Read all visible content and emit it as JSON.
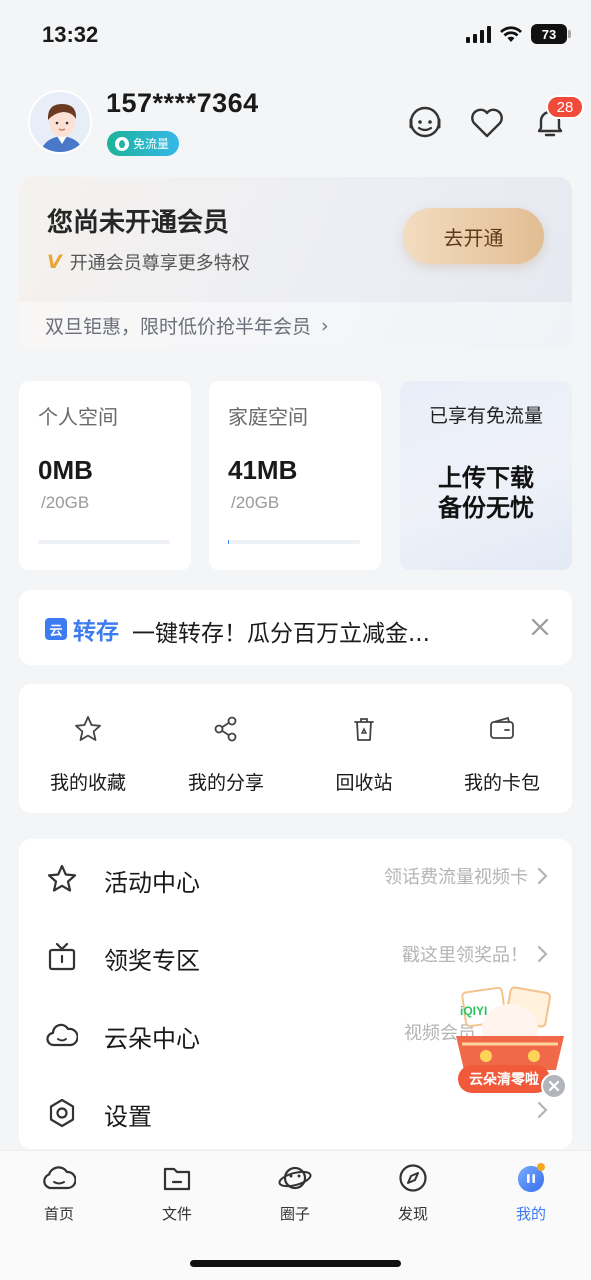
{
  "status": {
    "time": "13:32",
    "battery": "73"
  },
  "profile": {
    "phone": "157****7364",
    "free_badge": "免流量",
    "notification_count": "28"
  },
  "member": {
    "title": "您尚未开通会员",
    "subtitle": "开通会员尊享更多特权",
    "open_button": "去开通",
    "promo": "双旦钜惠，限时低价抢半年会员",
    "promo_arrow": "›"
  },
  "storage": {
    "personal": {
      "title": "个人空间",
      "used": "0MB",
      "capacity": "/20GB",
      "used_fraction": 0.0
    },
    "family": {
      "title": "家庭空间",
      "used": "41MB",
      "capacity": "/20GB",
      "used_fraction": 0.002
    },
    "flow": {
      "title": "已享有免流量",
      "line1": "上传下载",
      "line2": "备份无忧"
    }
  },
  "transfer": {
    "logo_text": "转存",
    "logo_box": "云",
    "text": "一键转存！瓜分百万立减金..."
  },
  "quick_actions": [
    {
      "label": "我的收藏",
      "icon": "star-icon"
    },
    {
      "label": "我的分享",
      "icon": "share-icon"
    },
    {
      "label": "回收站",
      "icon": "recycle-bin-icon"
    },
    {
      "label": "我的卡包",
      "icon": "wallet-icon"
    }
  ],
  "menu": [
    {
      "label": "活动中心",
      "hint": "领话费流量视频卡",
      "icon": "star-icon"
    },
    {
      "label": "领奖专区",
      "hint": "戳这里领奖品！",
      "icon": "tv-icon"
    },
    {
      "label": "云朵中心",
      "hint": "视频会员",
      "icon": "cloud-face-icon"
    },
    {
      "label": "设置",
      "hint": "",
      "icon": "settings-icon"
    }
  ],
  "float_promo": {
    "label": "云朵清零啦",
    "brand": "iQIYI"
  },
  "tabbar": [
    {
      "label": "首页",
      "icon": "home-cloud-icon",
      "active": false
    },
    {
      "label": "文件",
      "icon": "folder-icon",
      "active": false
    },
    {
      "label": "圈子",
      "icon": "planet-icon",
      "active": false
    },
    {
      "label": "发现",
      "icon": "compass-icon",
      "active": false
    },
    {
      "label": "我的",
      "icon": "profile-icon",
      "active": true
    }
  ],
  "colors": {
    "accent": "#3a7bfa",
    "active_tab": "#3d7cf0",
    "badge": "#f04a3a",
    "gold": "#e2bd93"
  }
}
